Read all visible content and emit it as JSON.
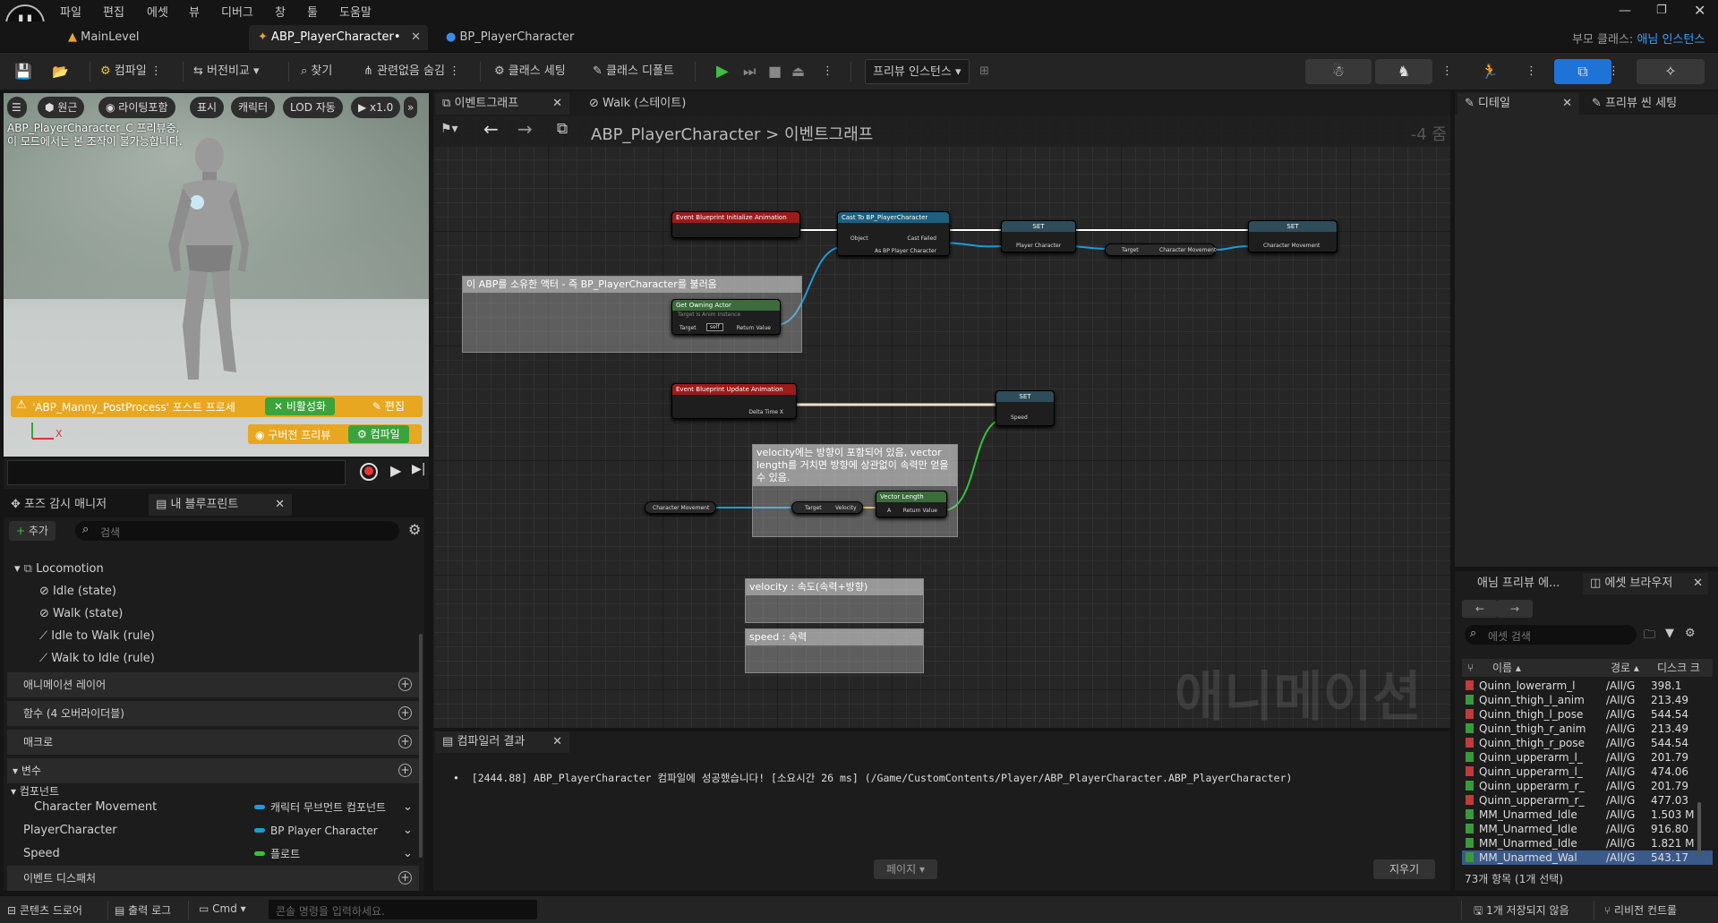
{
  "menu": [
    "파일",
    "편집",
    "에셋",
    "뷰",
    "디버그",
    "창",
    "툴",
    "도움말"
  ],
  "tabs": {
    "main_level": "MainLevel",
    "abp": "ABP_PlayerCharacter•",
    "bp": "BP_PlayerCharacter"
  },
  "parent_class": {
    "label": "부모 클래스:",
    "value": "애님 인스턴스"
  },
  "toolbar": {
    "compile": "컴파일",
    "diff": "버전비교",
    "find": "찾기",
    "hide_unrelated": "관련없음 숨김",
    "class_settings": "클래스 세팅",
    "class_defaults": "클래스 디폴트",
    "preview_instance": "프리뷰 인스턴스"
  },
  "viewport": {
    "perspective": "원근",
    "lit": "라이팅포함",
    "show": "표시",
    "character": "캐릭터",
    "lod": "LOD 자동",
    "speed": "x1.0",
    "info1": "ABP_PlayerCharacter_C 프리뷰중,",
    "info2": "이 모드에서는 본 조작이 불가능합니다.",
    "warning": "'ABP_Manny_PostProcess' 포스트 프로세",
    "disable": "비활성화",
    "edit": "편집",
    "outdated": "구버전 프리뷰",
    "compile_btn": "컴파일",
    "axis_x": "X"
  },
  "left_tabs": {
    "pose_watch": "포즈 감시 매니저",
    "my_blueprint": "내 블루프린트"
  },
  "my_blueprint": {
    "add": "추가",
    "search_placeholder": "검색",
    "locomotion": "Locomotion",
    "states": [
      "Idle (state)",
      "Walk (state)",
      "Idle to Walk (rule)",
      "Walk to Idle (rule)"
    ],
    "sections": {
      "anim_layers": "애니메이션 레이어",
      "functions": "함수 (4 오버라이더블)",
      "macros": "매크로",
      "variables": "변수",
      "components": "컴포넌트",
      "event_dispatchers": "이벤트 디스패처"
    },
    "vars": [
      {
        "name": "Character Movement",
        "type": "캐릭터 무브먼트 컴포넌트",
        "color": "#1f9bd8"
      },
      {
        "name": "PlayerCharacter",
        "type": "BP Player Character",
        "color": "#1f9bd8"
      },
      {
        "name": "Speed",
        "type": "플로트",
        "color": "#35c23a"
      }
    ]
  },
  "graph_tabs": {
    "event_graph": "이벤트그래프",
    "walk_state": "Walk (스테이트)"
  },
  "breadcrumb": {
    "root": "ABP_PlayerCharacter",
    "sep": ">",
    "current": "이벤트그래프",
    "zoom": "-4 줌"
  },
  "nodes": {
    "init": "Event Blueprint Initialize Animation",
    "cast": "Cast To BP_PlayerCharacter",
    "object": "Object",
    "cast_failed": "Cast Failed",
    "as_bp": "As BP Player Character",
    "set": "SET",
    "player_character": "Player Character",
    "target": "Target",
    "character_movement": "Character Movement",
    "get_owning": "Get Owning Actor",
    "target_is": "Target is Anim Instance",
    "self": "self",
    "return_value": "Return Value",
    "update": "Event Blueprint Update Animation",
    "delta": "Delta Time X",
    "speed": "Speed",
    "velocity": "Velocity",
    "vector_length": "Vector Length",
    "a": "A"
  },
  "comments": {
    "c1": "이 ABP를 소유한 액터 - 즉 BP_PlayerCharacter를 불러옴",
    "c2": "velocity에는 방향이 포함되어 있음, vector length를 거치면 방향에 상관없이 속력만 얻을 수 있음.",
    "c3": "velocity : 속도(속력+방향)",
    "c4": "speed : 속력"
  },
  "watermark": "애니메이션",
  "compiler": {
    "tab": "컴파일러 결과",
    "message": "[2444.88] ABP_PlayerCharacter 컴파일에 성공했습니다! [소요시간 26 ms] (/Game/CustomContents/Player/ABP_PlayerCharacter.ABP_PlayerCharacter)",
    "page": "페이지",
    "clear": "지우기"
  },
  "right_tabs": {
    "details": "디테일",
    "preview_scene": "프리뷰 씬 세팅",
    "anim_preview": "애님 프리뷰 에...",
    "asset_browser": "에셋 브라우저"
  },
  "asset_browser": {
    "search_placeholder": "에셋 검색",
    "col_name": "이름",
    "col_path": "경로",
    "col_disk": "디스크 크",
    "count": "73개 항목 (1개 선택)",
    "rows": [
      {
        "name": "Quinn_lowerarm_l",
        "path": "/All/G",
        "size": "398.1",
        "color": "#c23a3a"
      },
      {
        "name": "Quinn_thigh_l_anim",
        "path": "/All/G",
        "size": "213.49",
        "color": "#3a9a3a"
      },
      {
        "name": "Quinn_thigh_l_pose",
        "path": "/All/G",
        "size": "544.54",
        "color": "#c23a3a"
      },
      {
        "name": "Quinn_thigh_r_anim",
        "path": "/All/G",
        "size": "213.49",
        "color": "#3a9a3a"
      },
      {
        "name": "Quinn_thigh_r_pose",
        "path": "/All/G",
        "size": "544.54",
        "color": "#c23a3a"
      },
      {
        "name": "Quinn_upperarm_l_",
        "path": "/All/G",
        "size": "201.79",
        "color": "#3a9a3a"
      },
      {
        "name": "Quinn_upperarm_l_",
        "path": "/All/G",
        "size": "474.06",
        "color": "#c23a3a"
      },
      {
        "name": "Quinn_upperarm_r_",
        "path": "/All/G",
        "size": "201.79",
        "color": "#3a9a3a"
      },
      {
        "name": "Quinn_upperarm_r_",
        "path": "/All/G",
        "size": "477.03",
        "color": "#c23a3a"
      },
      {
        "name": "MM_Unarmed_Idle",
        "path": "/All/G",
        "size": "1.503 M",
        "color": "#3a9a3a"
      },
      {
        "name": "MM_Unarmed_Idle",
        "path": "/All/G",
        "size": "916.80",
        "color": "#3a9a3a"
      },
      {
        "name": "MM_Unarmed_Idle",
        "path": "/All/G",
        "size": "1.821 M",
        "color": "#3a9a3a"
      },
      {
        "name": "MM_Unarmed_Wal",
        "path": "/All/G",
        "size": "543.17",
        "color": "#3a9a3a"
      }
    ]
  },
  "statusbar": {
    "content_drawer": "콘텐츠 드로어",
    "output_log": "출력 로그",
    "cmd": "Cmd",
    "console_placeholder": "콘솔 명령을 입력하세요.",
    "unsaved": "1개 저장되지 않음",
    "revision": "리비전 컨트롤"
  }
}
